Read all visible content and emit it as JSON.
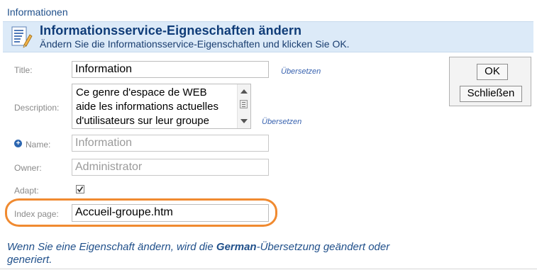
{
  "breadcrumb": "Informationen",
  "header": {
    "title": "Informationsservice-Eigneschaften ändern",
    "subtitle": "Ändern Sie die Informationsservice-Eigenschaften und klicken Sie OK."
  },
  "form": {
    "title_label": "Title:",
    "title_value": "Information",
    "title_translate": "Übersetzen",
    "description_label": "Description:",
    "description_lines": [
      "Ce genre d'espace de WEB",
      "aide les informations actuelles",
      "d'utilisateurs sur leur groupe"
    ],
    "description_translate": "Übersetzen",
    "name_label": "Name:",
    "name_value": "Information",
    "owner_label": "Owner:",
    "owner_value": "Administrator",
    "adapt_label": "Adapt:",
    "adapt_checked": true,
    "index_label": "Index page:",
    "index_value": "Accueil-groupe.htm"
  },
  "buttons": {
    "ok": "OK",
    "close": "Schließen"
  },
  "footer": {
    "part1": "Wenn Sie eine Eigenschaft ändern, wird die ",
    "lang": "German",
    "part2": "-Übersetzung geändert oder generiert."
  },
  "colors": {
    "header_bg": "#dceaf8",
    "title": "#0f3c78",
    "link": "#3a64b0",
    "highlight": "#f08a30"
  },
  "icons": {
    "header": "document-edit-icon",
    "name_required": "plus-circle-icon",
    "checkbox": "checkmark-icon"
  }
}
